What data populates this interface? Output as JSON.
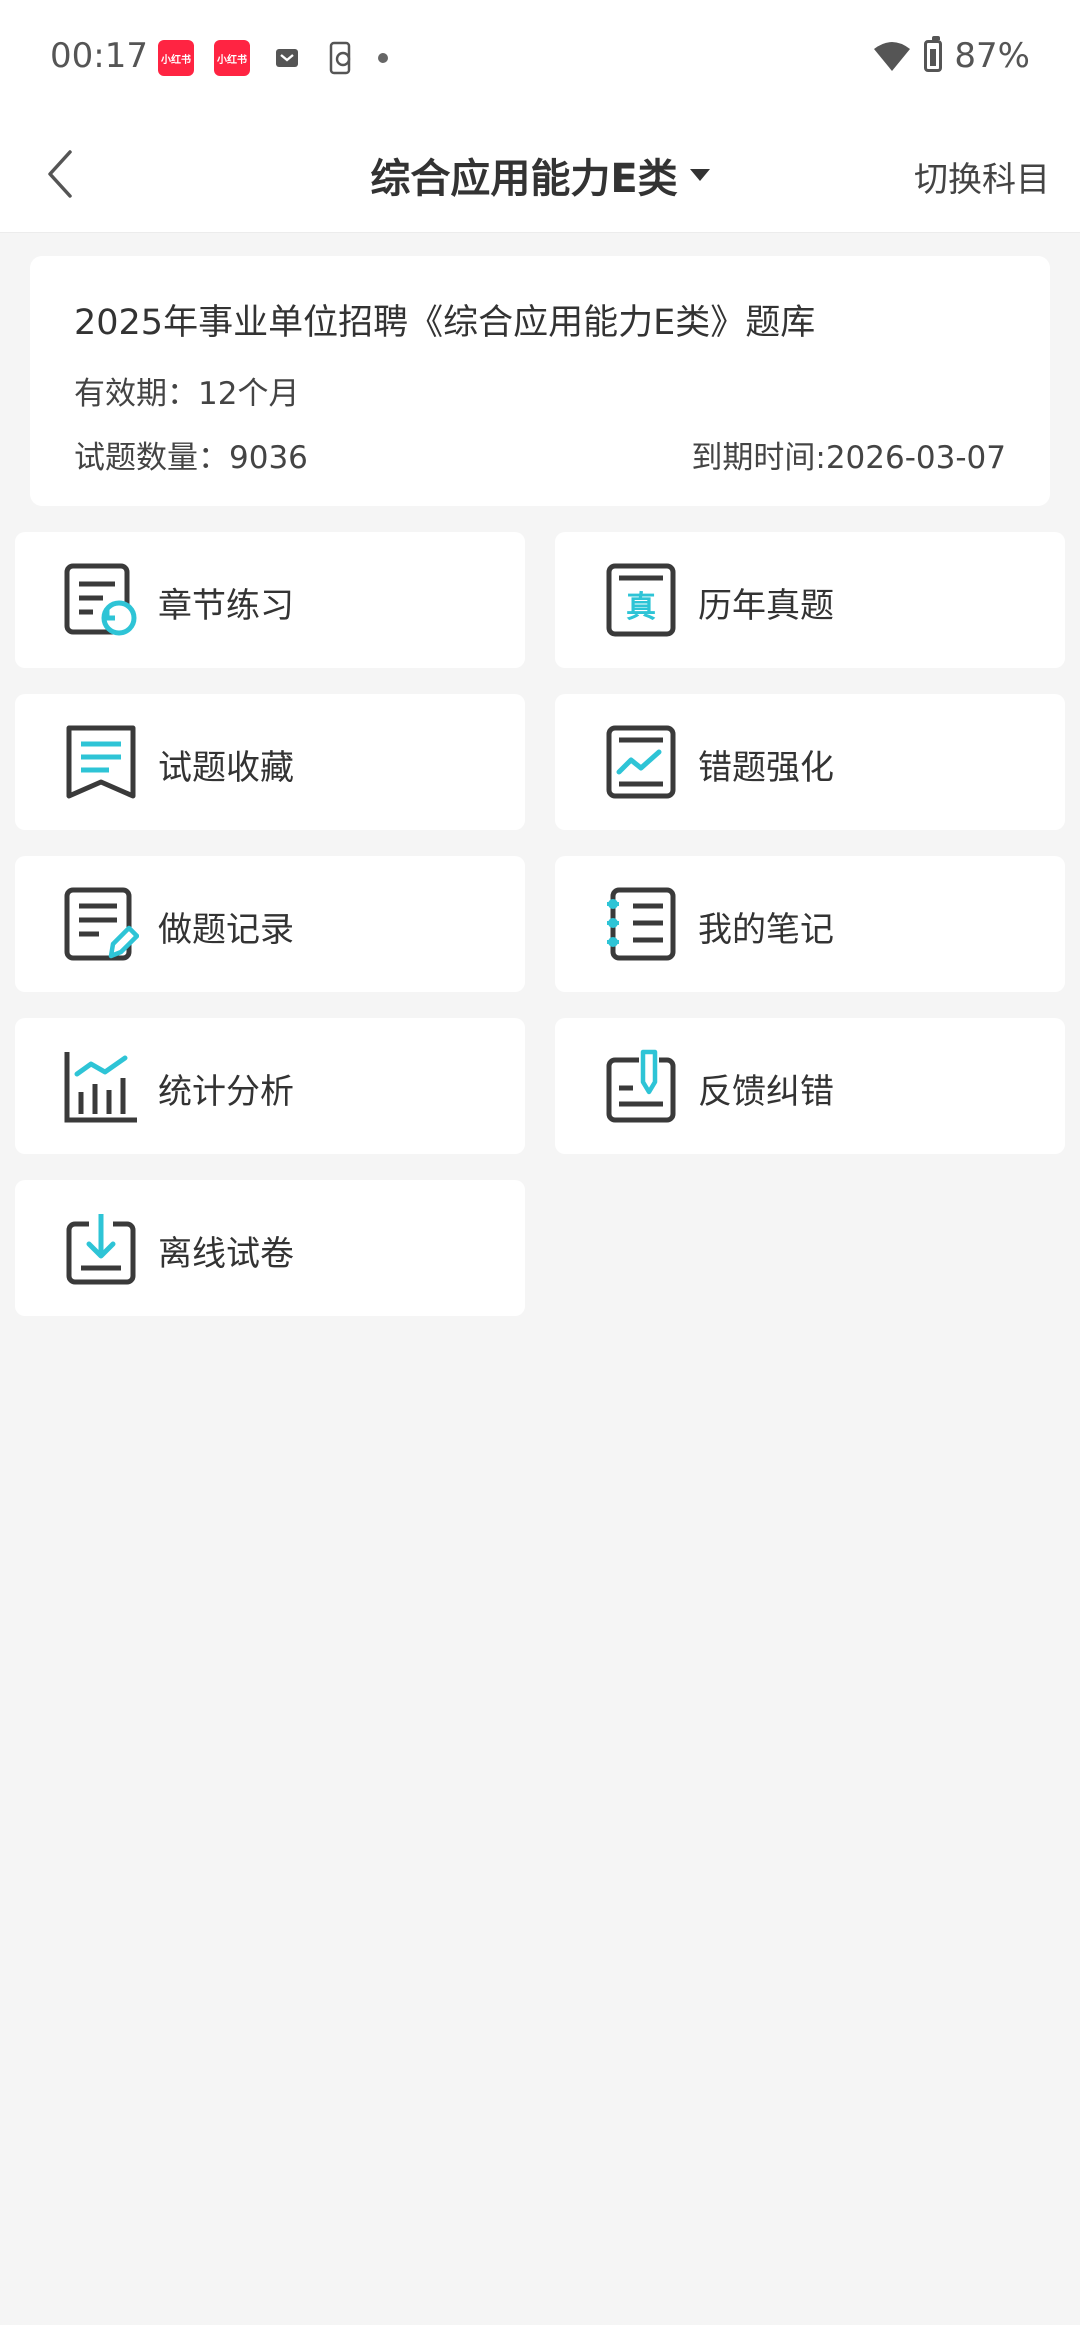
{
  "status_bar": {
    "time": "00:17",
    "app_badge_1": "小红书",
    "app_badge_2": "小红书",
    "battery": "87%"
  },
  "nav": {
    "title": "综合应用能力E类",
    "switch_label": "切换科目"
  },
  "info": {
    "title": "2025年事业单位招聘《综合应用能力E类》题库",
    "validity": "有效期：12个月",
    "count": "试题数量：9036",
    "expire": "到期时间:2026-03-07"
  },
  "menu": [
    {
      "label": "章节练习",
      "icon": "chapter-practice-icon"
    },
    {
      "label": "历年真题",
      "icon": "past-exams-icon"
    },
    {
      "label": "试题收藏",
      "icon": "bookmark-icon"
    },
    {
      "label": "错题强化",
      "icon": "mistake-reinforce-icon"
    },
    {
      "label": "做题记录",
      "icon": "record-edit-icon"
    },
    {
      "label": "我的笔记",
      "icon": "notebook-icon"
    },
    {
      "label": "统计分析",
      "icon": "statistics-icon"
    },
    {
      "label": "反馈纠错",
      "icon": "feedback-icon"
    },
    {
      "label": "离线试卷",
      "icon": "download-icon"
    }
  ],
  "colors": {
    "accent": "#2ec4d6",
    "icon_dark": "#3a3a3a",
    "background": "#f5f5f5"
  }
}
